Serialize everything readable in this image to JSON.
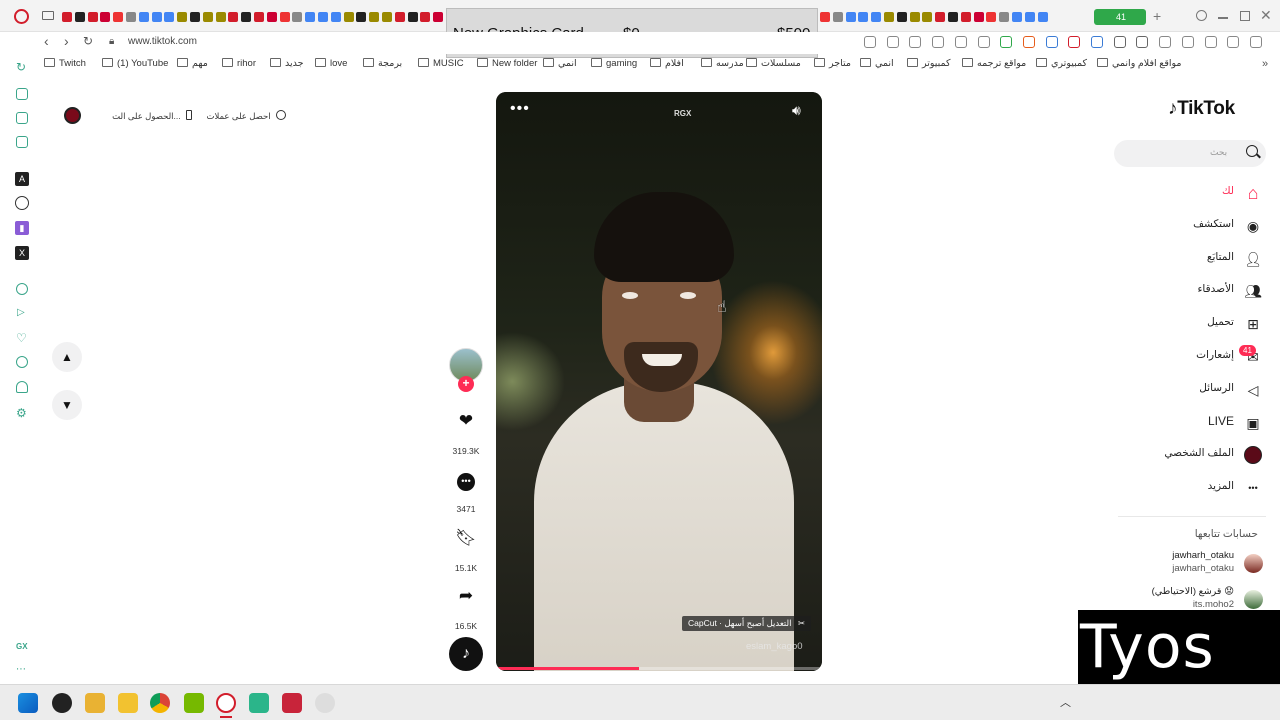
{
  "browser": {
    "url": "www.tiktok.com",
    "tab_counter": "41",
    "bookmarks": [
      "Twitch",
      "(1) YouTube",
      "مهم",
      "rihor",
      "جديد",
      "love",
      "برمجة",
      "MUSIC",
      "New folder",
      "انمي",
      "gaming",
      "افلام",
      "مدرسه",
      "مسلسلات",
      "متاجر",
      "انمي",
      "كمبيوتر",
      "مواقع ترجمه",
      "كمبيوتري",
      "مواقع افلام وانمي"
    ]
  },
  "overlay": {
    "name": "New Graphics Card",
    "price_now": "$0",
    "price_target": "$500"
  },
  "top_left": {
    "coins_label": "احصل على عملات",
    "app_label": "الحصول على الت..."
  },
  "video": {
    "badge": "RGX",
    "caption": "CapCut · التعديل أصبح أسهل",
    "author": "eslam_kago0",
    "progress_fraction": 0.44
  },
  "actions": {
    "likes": "319.3K",
    "comments": "3471",
    "saves": "15.1K",
    "shares": "16.5K"
  },
  "tiktok": {
    "logo": "TikTok",
    "search_placeholder": "بحث",
    "nav": [
      {
        "label": "لك",
        "icon": "home-icon"
      },
      {
        "label": "استكشف",
        "icon": "compass-icon"
      },
      {
        "label": "المتابَع",
        "icon": "follow-icon"
      },
      {
        "label": "الأصدقاء",
        "icon": "friends-icon"
      },
      {
        "label": "تحميل",
        "icon": "upload-icon"
      },
      {
        "label": "إشعارات",
        "icon": "inbox-icon"
      },
      {
        "label": "الرسائل",
        "icon": "send-icon"
      },
      {
        "label": "LIVE",
        "icon": "live-icon"
      },
      {
        "label": "الملف الشخصي",
        "icon": "profile-icon"
      },
      {
        "label": "المزيد",
        "icon": "more-icon"
      }
    ],
    "notifications_badge": "41",
    "following_title": "حسابات تتابعها",
    "accounts": [
      {
        "name": "jawharh_otaku",
        "handle": "jawharh_otaku"
      },
      {
        "name": "قرشع (الاحتياطي) 😟",
        "handle": "its.moho2"
      }
    ]
  },
  "watermark": "Tyos",
  "colors": {
    "accent": "#fe2c55",
    "opera": "#d21d2b"
  }
}
